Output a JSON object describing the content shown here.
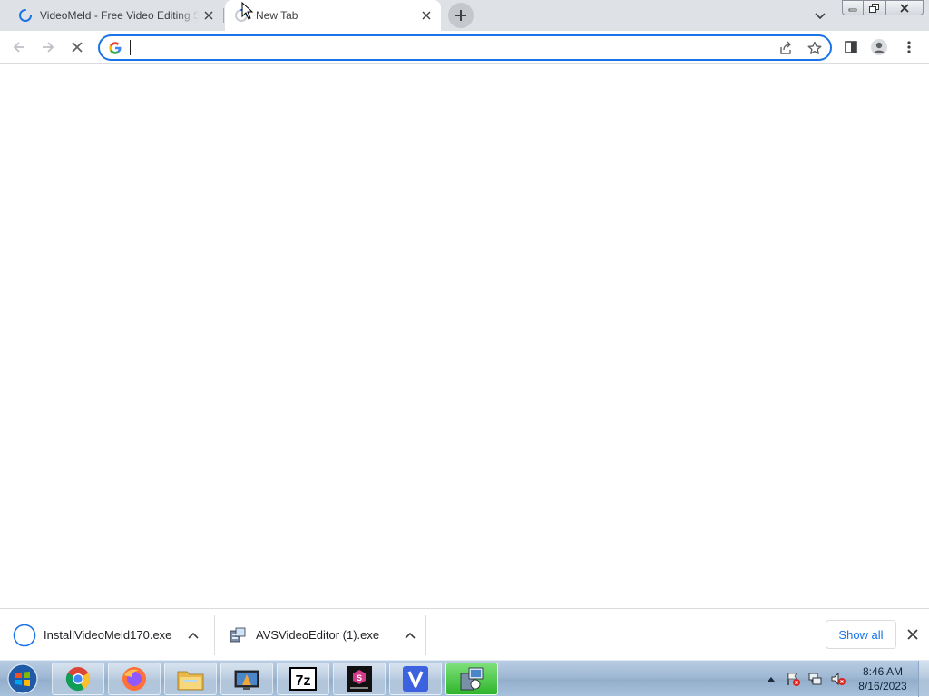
{
  "tabs": [
    {
      "title": "VideoMeld - Free Video Editing Software",
      "loading": true,
      "active": false
    },
    {
      "title": "New Tab",
      "loading": true,
      "active": true
    }
  ],
  "new_tab_tooltip": "New tab",
  "omnibox": {
    "value": "",
    "placeholder": ""
  },
  "downloads": [
    {
      "name": "InstallVideoMeld170.exe",
      "icon": "progress-ring-icon"
    },
    {
      "name": "AVSVideoEditor (1).exe",
      "icon": "installer-icon"
    }
  ],
  "shelf": {
    "show_all_label": "Show all"
  },
  "taskbar": {
    "apps": [
      "chrome-icon",
      "firefox-icon",
      "file-explorer-icon",
      "media-app-icon",
      "7zip-icon",
      "flake-designer-icon",
      "v-app-icon",
      "installer-app-icon"
    ],
    "time": "8:46 AM",
    "date": "8/16/2023"
  },
  "colors": {
    "accent": "#1a73e8",
    "tabstrip": "#dee1e6",
    "taskbar": "#9fb8d3"
  }
}
